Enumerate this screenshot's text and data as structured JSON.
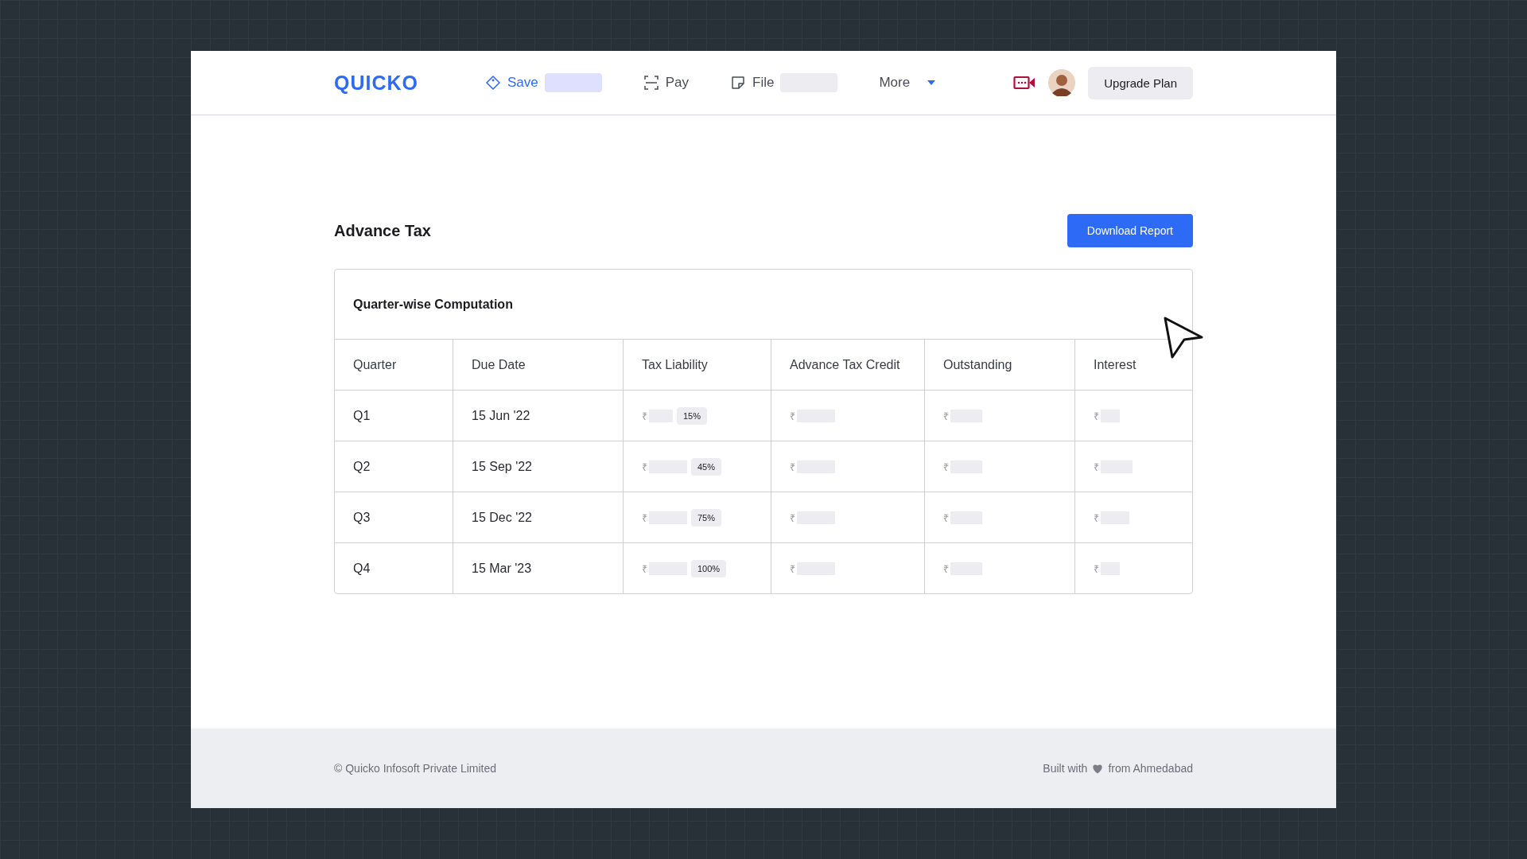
{
  "header": {
    "logo": "QUICKO",
    "nav": [
      {
        "label": "Save",
        "kind": "tag",
        "selected": true,
        "pill": true
      },
      {
        "label": "Pay",
        "kind": "scan",
        "selected": false,
        "pill": false
      },
      {
        "label": "File",
        "kind": "note",
        "selected": false,
        "pill": true
      },
      {
        "label": "More",
        "kind": "dropdown",
        "selected": false,
        "pill": false
      }
    ],
    "upgrade_button": "Upgrade Plan"
  },
  "page": {
    "title": "Advance Tax",
    "download_button": "Download Report"
  },
  "table": {
    "title": "Quarter-wise Computation",
    "columns": [
      "Quarter",
      "Due Date",
      "Tax Liability",
      "Advance Tax Credit",
      "Outstanding",
      "Interest"
    ],
    "rows": [
      {
        "quarter": "Q1",
        "due_date": "15 Jun '22",
        "currency": "₹",
        "share": "15%"
      },
      {
        "quarter": "Q2",
        "due_date": "15 Sep '22",
        "currency": "₹",
        "share": "45%"
      },
      {
        "quarter": "Q3",
        "due_date": "15 Dec '22",
        "currency": "₹",
        "share": "75%"
      },
      {
        "quarter": "Q4",
        "due_date": "15 Mar '23",
        "currency": "₹",
        "share": "100%"
      }
    ]
  },
  "footer": {
    "copyright": "© Quicko Infosoft Private Limited",
    "built_with": "Built with",
    "from": "from Ahmedabad"
  }
}
